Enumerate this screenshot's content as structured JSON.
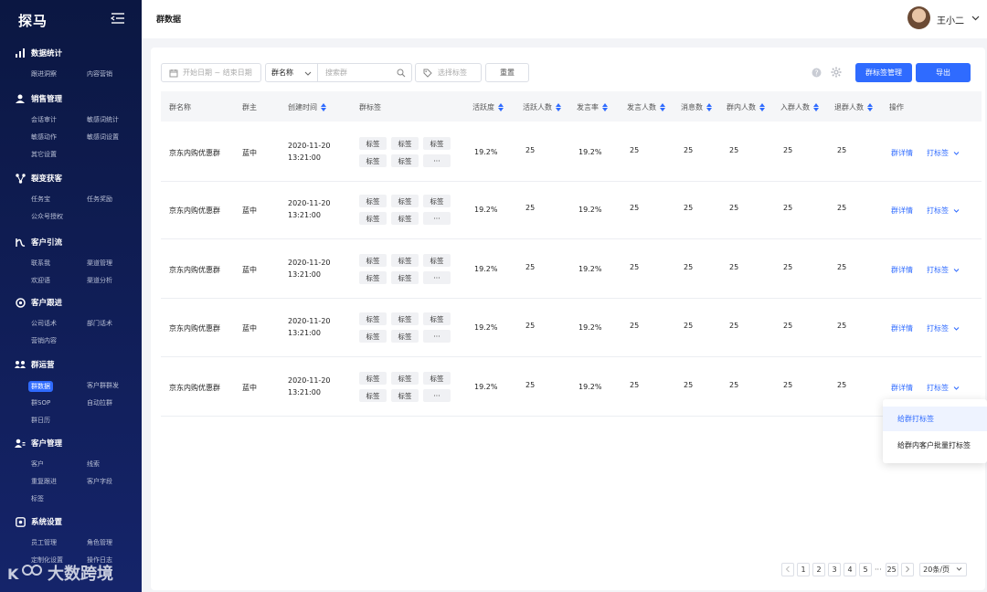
{
  "app": {
    "name": "探马"
  },
  "sidebar": {
    "sections": [
      {
        "title": "数据统计",
        "icon": "bar-chart-icon",
        "items": [
          "跟进洞察",
          "内容营销"
        ]
      },
      {
        "title": "销售管理",
        "icon": "person-icon",
        "items": [
          "会话审计",
          "敏感词统计",
          "敏感动作",
          "敏感词设置",
          "其它设置"
        ]
      },
      {
        "title": "裂变获客",
        "icon": "share-icon",
        "items": [
          "任务宝",
          "任务奖励",
          "公众号授权"
        ]
      },
      {
        "title": "客户引流",
        "icon": "funnel-icon",
        "items": [
          "联系我",
          "渠道管理",
          "欢迎语",
          "渠道分析"
        ]
      },
      {
        "title": "客户跟进",
        "icon": "compass-icon",
        "items": [
          "公司话术",
          "部门话术",
          "营销内容"
        ]
      },
      {
        "title": "群运营",
        "icon": "group-icon",
        "items": [
          "群数据",
          "客户群群发",
          "群SOP",
          "自动拉群",
          "群日历"
        ]
      },
      {
        "title": "客户管理",
        "icon": "user-manage-icon",
        "items": [
          "客户",
          "线索",
          "重复跟进",
          "客户字段",
          "标签"
        ]
      },
      {
        "title": "系统设置",
        "icon": "settings-icon",
        "items": [
          "员工管理",
          "角色管理",
          "定制化设置",
          "操作日志"
        ]
      }
    ],
    "active_item": "群数据"
  },
  "watermark": {
    "text": "大数跨境"
  },
  "header": {
    "title": "群数据",
    "user_name": "王小二"
  },
  "toolbar": {
    "date_placeholder": "开始日期 ~ 结束日期",
    "select_value": "群名称",
    "search_placeholder": "搜索群",
    "tag_placeholder": "选择标签",
    "reset_label": "重置",
    "tag_manage_label": "群标签管理",
    "export_label": "导出"
  },
  "table": {
    "columns": [
      "群名称",
      "群主",
      "创建时间",
      "群标签",
      "活跃度",
      "活跃人数",
      "发言率",
      "发言人数",
      "消息数",
      "群内人数",
      "入群人数",
      "退群人数",
      "操作"
    ],
    "rows": [
      {
        "name": "京东内购优惠群",
        "owner": "蓝中",
        "date": "2020-11-20",
        "time": "13:21:00",
        "tags": [
          "标签",
          "标签",
          "标签",
          "标签",
          "标签",
          "···"
        ],
        "activity": "19.2%",
        "active_count": "25",
        "speak_rate": "19.2%",
        "speakers": "25",
        "messages": "25",
        "members": "25",
        "joined": "25",
        "left": "25",
        "detail": "群详情",
        "tag_action": "打标签"
      },
      {
        "name": "京东内购优惠群",
        "owner": "蓝中",
        "date": "2020-11-20",
        "time": "13:21:00",
        "tags": [
          "标签",
          "标签",
          "标签",
          "标签",
          "标签",
          "···"
        ],
        "activity": "19.2%",
        "active_count": "25",
        "speak_rate": "19.2%",
        "speakers": "25",
        "messages": "25",
        "members": "25",
        "joined": "25",
        "left": "25",
        "detail": "群详情",
        "tag_action": "打标签"
      },
      {
        "name": "京东内购优惠群",
        "owner": "蓝中",
        "date": "2020-11-20",
        "time": "13:21:00",
        "tags": [
          "标签",
          "标签",
          "标签",
          "标签",
          "标签",
          "···"
        ],
        "activity": "19.2%",
        "active_count": "25",
        "speak_rate": "19.2%",
        "speakers": "25",
        "messages": "25",
        "members": "25",
        "joined": "25",
        "left": "25",
        "detail": "群详情",
        "tag_action": "打标签"
      },
      {
        "name": "京东内购优惠群",
        "owner": "蓝中",
        "date": "2020-11-20",
        "time": "13:21:00",
        "tags": [
          "标签",
          "标签",
          "标签",
          "标签",
          "标签",
          "···"
        ],
        "activity": "19.2%",
        "active_count": "25",
        "speak_rate": "19.2%",
        "speakers": "25",
        "messages": "25",
        "members": "25",
        "joined": "25",
        "left": "25",
        "detail": "群详情",
        "tag_action": "打标签"
      },
      {
        "name": "京东内购优惠群",
        "owner": "蓝中",
        "date": "2020-11-20",
        "time": "13:21:00",
        "tags": [
          "标签",
          "标签",
          "标签",
          "标签",
          "标签",
          "···"
        ],
        "activity": "19.2%",
        "active_count": "25",
        "speak_rate": "19.2%",
        "speakers": "25",
        "messages": "25",
        "members": "25",
        "joined": "25",
        "left": "25",
        "detail": "群详情",
        "tag_action": "打标签"
      }
    ]
  },
  "dropdown": {
    "items": [
      "给群打标签",
      "给群内客户批量打标签"
    ]
  },
  "pagination": {
    "pages": [
      "1",
      "2",
      "3",
      "4",
      "5",
      "···",
      "25"
    ],
    "page_size": "20条/页"
  },
  "colors": {
    "primary": "#2f6bff",
    "sidebar": "#0b1742"
  }
}
